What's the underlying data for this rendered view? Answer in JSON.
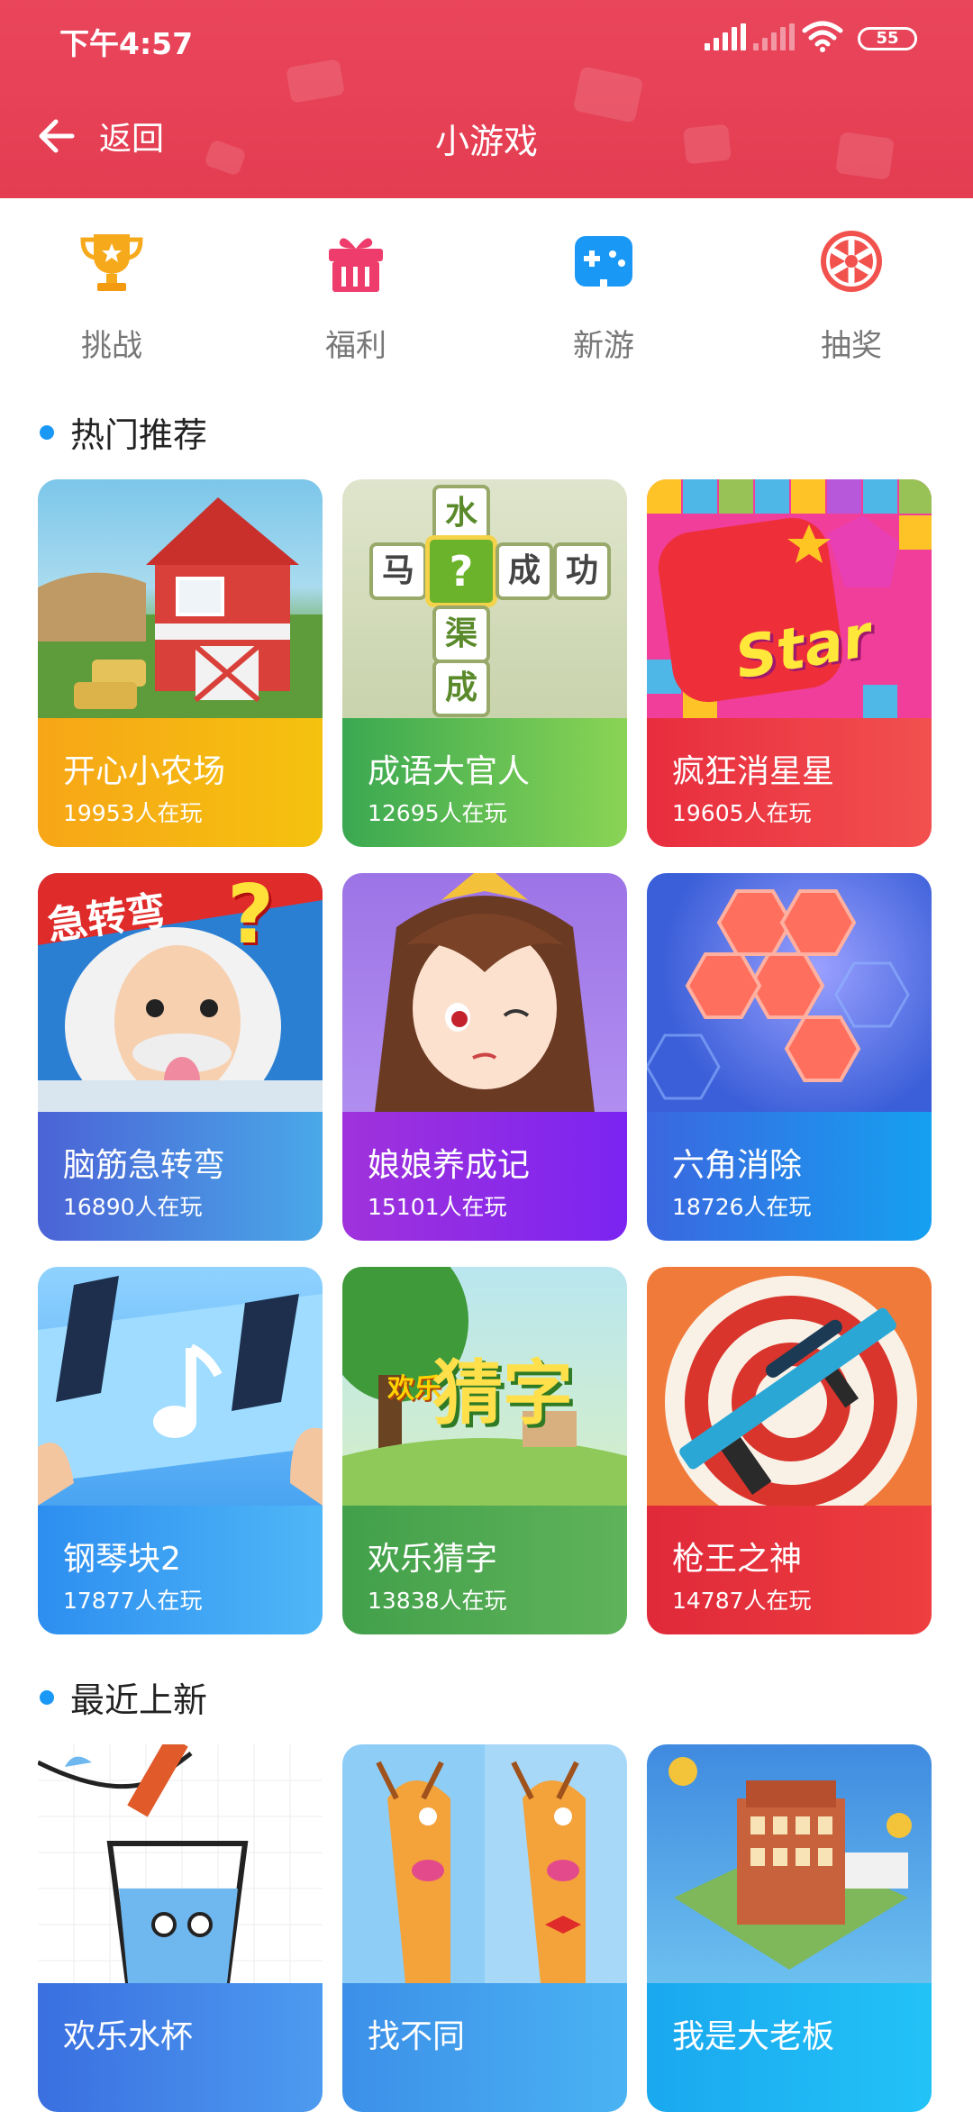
{
  "status": {
    "time": "下午4:57",
    "battery": "55"
  },
  "nav": {
    "back_label": "返回",
    "title": "小游戏"
  },
  "categories": [
    {
      "label": "挑战",
      "icon": "trophy-icon"
    },
    {
      "label": "福利",
      "icon": "gift-icon"
    },
    {
      "label": "新游",
      "icon": "gamepad-icon"
    },
    {
      "label": "抽奖",
      "icon": "wheel-icon"
    }
  ],
  "sections": {
    "hot": "热门推荐",
    "recent": "最近上新"
  },
  "hot_games": [
    {
      "name": "开心小农场",
      "players": "19953人在玩"
    },
    {
      "name": "成语大官人",
      "players": "12695人在玩"
    },
    {
      "name": "疯狂消星星",
      "players": "19605人在玩"
    },
    {
      "name": "脑筋急转弯",
      "players": "16890人在玩"
    },
    {
      "name": "娘娘养成记",
      "players": "15101人在玩"
    },
    {
      "name": "六角消除",
      "players": "18726人在玩"
    },
    {
      "name": "钢琴块2",
      "players": "17877人在玩"
    },
    {
      "name": "欢乐猜字",
      "players": "13838人在玩"
    },
    {
      "name": "枪王之神",
      "players": "14787人在玩"
    }
  ],
  "recent_games": [
    {
      "name": "欢乐水杯"
    },
    {
      "name": "找不同"
    },
    {
      "name": "我是大老板"
    }
  ],
  "art_text": {
    "idiom_chars": [
      "水",
      "马",
      "?",
      "成",
      "功",
      "渠",
      "成"
    ],
    "star_word": "Star",
    "riddle_banner": "急转弯",
    "riddle_mark": "?",
    "guess_word": "猜字",
    "guess_small": "欢乐"
  },
  "colors": {
    "header": "#e43d52",
    "accent_dot": "#1a98f5"
  }
}
